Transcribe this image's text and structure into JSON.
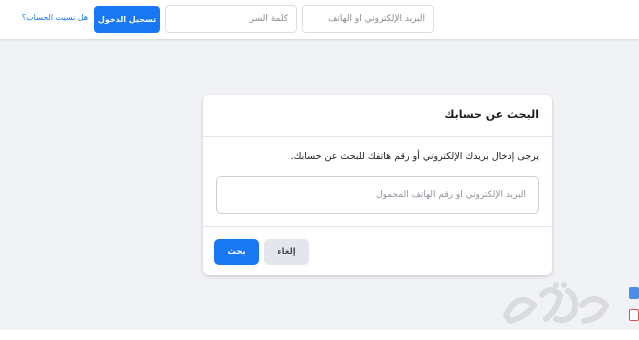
{
  "header": {
    "email_placeholder": "البريد الإلكتروني أو الهاتف",
    "password_placeholder": "كلمة السر",
    "login_label": "تسجيل الدخول",
    "forgot_label": "هل نسيت الحساب؟"
  },
  "card": {
    "title": "البحث عن حسابك",
    "description": "يرجى إدخال بريدك الإلكتروني أو رقم هاتفك للبحث عن حسابك.",
    "input_placeholder": "البريد الإلكتروني أو رقم الهاتف المحمول",
    "search_label": "بحث",
    "cancel_label": "إلغاء"
  },
  "watermark": {
    "text": "رؤيا"
  },
  "colors": {
    "brand_blue": "#1877f2",
    "page_background": "#f0f2f5",
    "cancel_gray": "#e4e6eb"
  }
}
